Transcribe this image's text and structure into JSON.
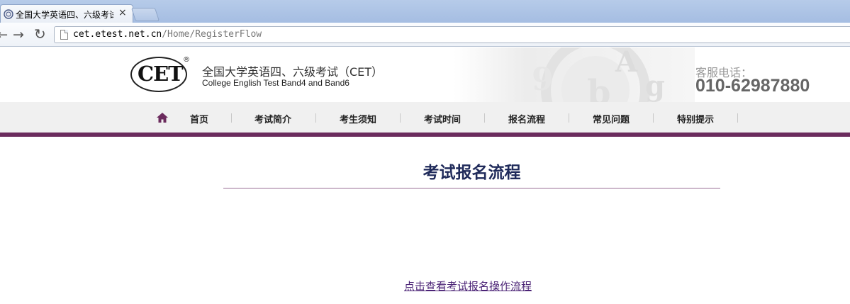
{
  "browser": {
    "tab_title": "全国大学英语四、六级考试",
    "close_glyph": "×",
    "url_host": "cet.etest.net.cn",
    "url_path": "/Home/RegisterFlow"
  },
  "header": {
    "logo_text": "CET",
    "logo_registered": "®",
    "title": "全国大学英语四、六级考试（CET）",
    "subtitle": "College English Test Band4 and Band6",
    "hotline_label": "客服电话：",
    "hotline_number": "010-62987880",
    "deco_letters": [
      "A",
      "b",
      "g",
      "9"
    ]
  },
  "nav": {
    "items": [
      {
        "label": "首页"
      },
      {
        "label": "考试简介"
      },
      {
        "label": "考生须知"
      },
      {
        "label": "考试时间"
      },
      {
        "label": "报名流程"
      },
      {
        "label": "常见问题"
      },
      {
        "label": "特别提示"
      }
    ]
  },
  "main": {
    "title": "考试报名流程",
    "link_text": "点击查看考试报名操作流程"
  },
  "colors": {
    "nav_accent": "#6b2b5d",
    "title_color": "#1f2a5a",
    "link_color": "#4b2376"
  }
}
